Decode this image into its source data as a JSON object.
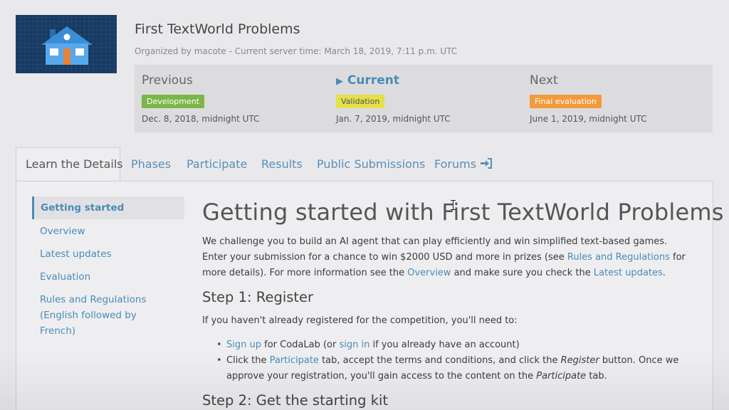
{
  "header": {
    "title": "First TextWorld Problems",
    "subtitle": "Organized by macote - Current server time: March 18, 2019, 7:11 p.m. UTC"
  },
  "phases": {
    "previous": {
      "label": "Previous",
      "badge": "Development",
      "badge_color": "#7ab648",
      "date": "Dec. 8, 2018, midnight UTC"
    },
    "current": {
      "label": "Current",
      "badge": "Validation",
      "badge_color": "#e4e04a",
      "date": "Jan. 7, 2019, midnight UTC"
    },
    "next": {
      "label": "Next",
      "badge": "Final evaluation",
      "badge_color": "#f29a3c",
      "date": "June 1, 2019, midnight UTC"
    }
  },
  "tabs": [
    {
      "label": "Learn the Details",
      "active": true
    },
    {
      "label": "Phases"
    },
    {
      "label": "Participate"
    },
    {
      "label": "Results"
    },
    {
      "label": "Public Submissions"
    },
    {
      "label": "Forums",
      "icon": "sign-in-icon"
    }
  ],
  "sidebar": {
    "items": [
      {
        "label": "Getting started",
        "active": true
      },
      {
        "label": "Overview"
      },
      {
        "label": "Latest updates"
      },
      {
        "label": "Evaluation"
      },
      {
        "label": "Rules and Regulations (English followed by French)"
      }
    ]
  },
  "content": {
    "heading": "Getting started with First TextWorld Problems",
    "intro": {
      "t1": "We challenge you to build an AI agent that can play efficiently and win simplified text-based games. Enter your submission for a chance to win $2000 USD and more in prizes (see ",
      "link_rules": "Rules and Regulations",
      "t2": " for more details). For more information see the ",
      "link_overview": "Overview",
      "t3": " and make sure you check the ",
      "link_updates": "Latest updates",
      "t4": "."
    },
    "step1": {
      "heading": "Step 1: Register",
      "text": "If you haven't already registered for the competition, you'll need to:",
      "bullet1": {
        "link_signup": "Sign up",
        "t1": " for CodaLab (or ",
        "link_signin": "sign in",
        "t2": " if you already have an account)"
      },
      "bullet2": {
        "t1": "Click the ",
        "link_participate": "Participate",
        "t2": " tab, accept the terms and conditions, and click the ",
        "em_register": "Register",
        "t3": " button. Once we approve your registration, you'll gain access to the content on the ",
        "em_participate": "Participate",
        "t4": " tab."
      }
    },
    "step2": {
      "heading": "Step 2: Get the starting kit"
    }
  },
  "colors": {
    "link": "#4b8bb5",
    "logo_bg": "#163a64"
  }
}
